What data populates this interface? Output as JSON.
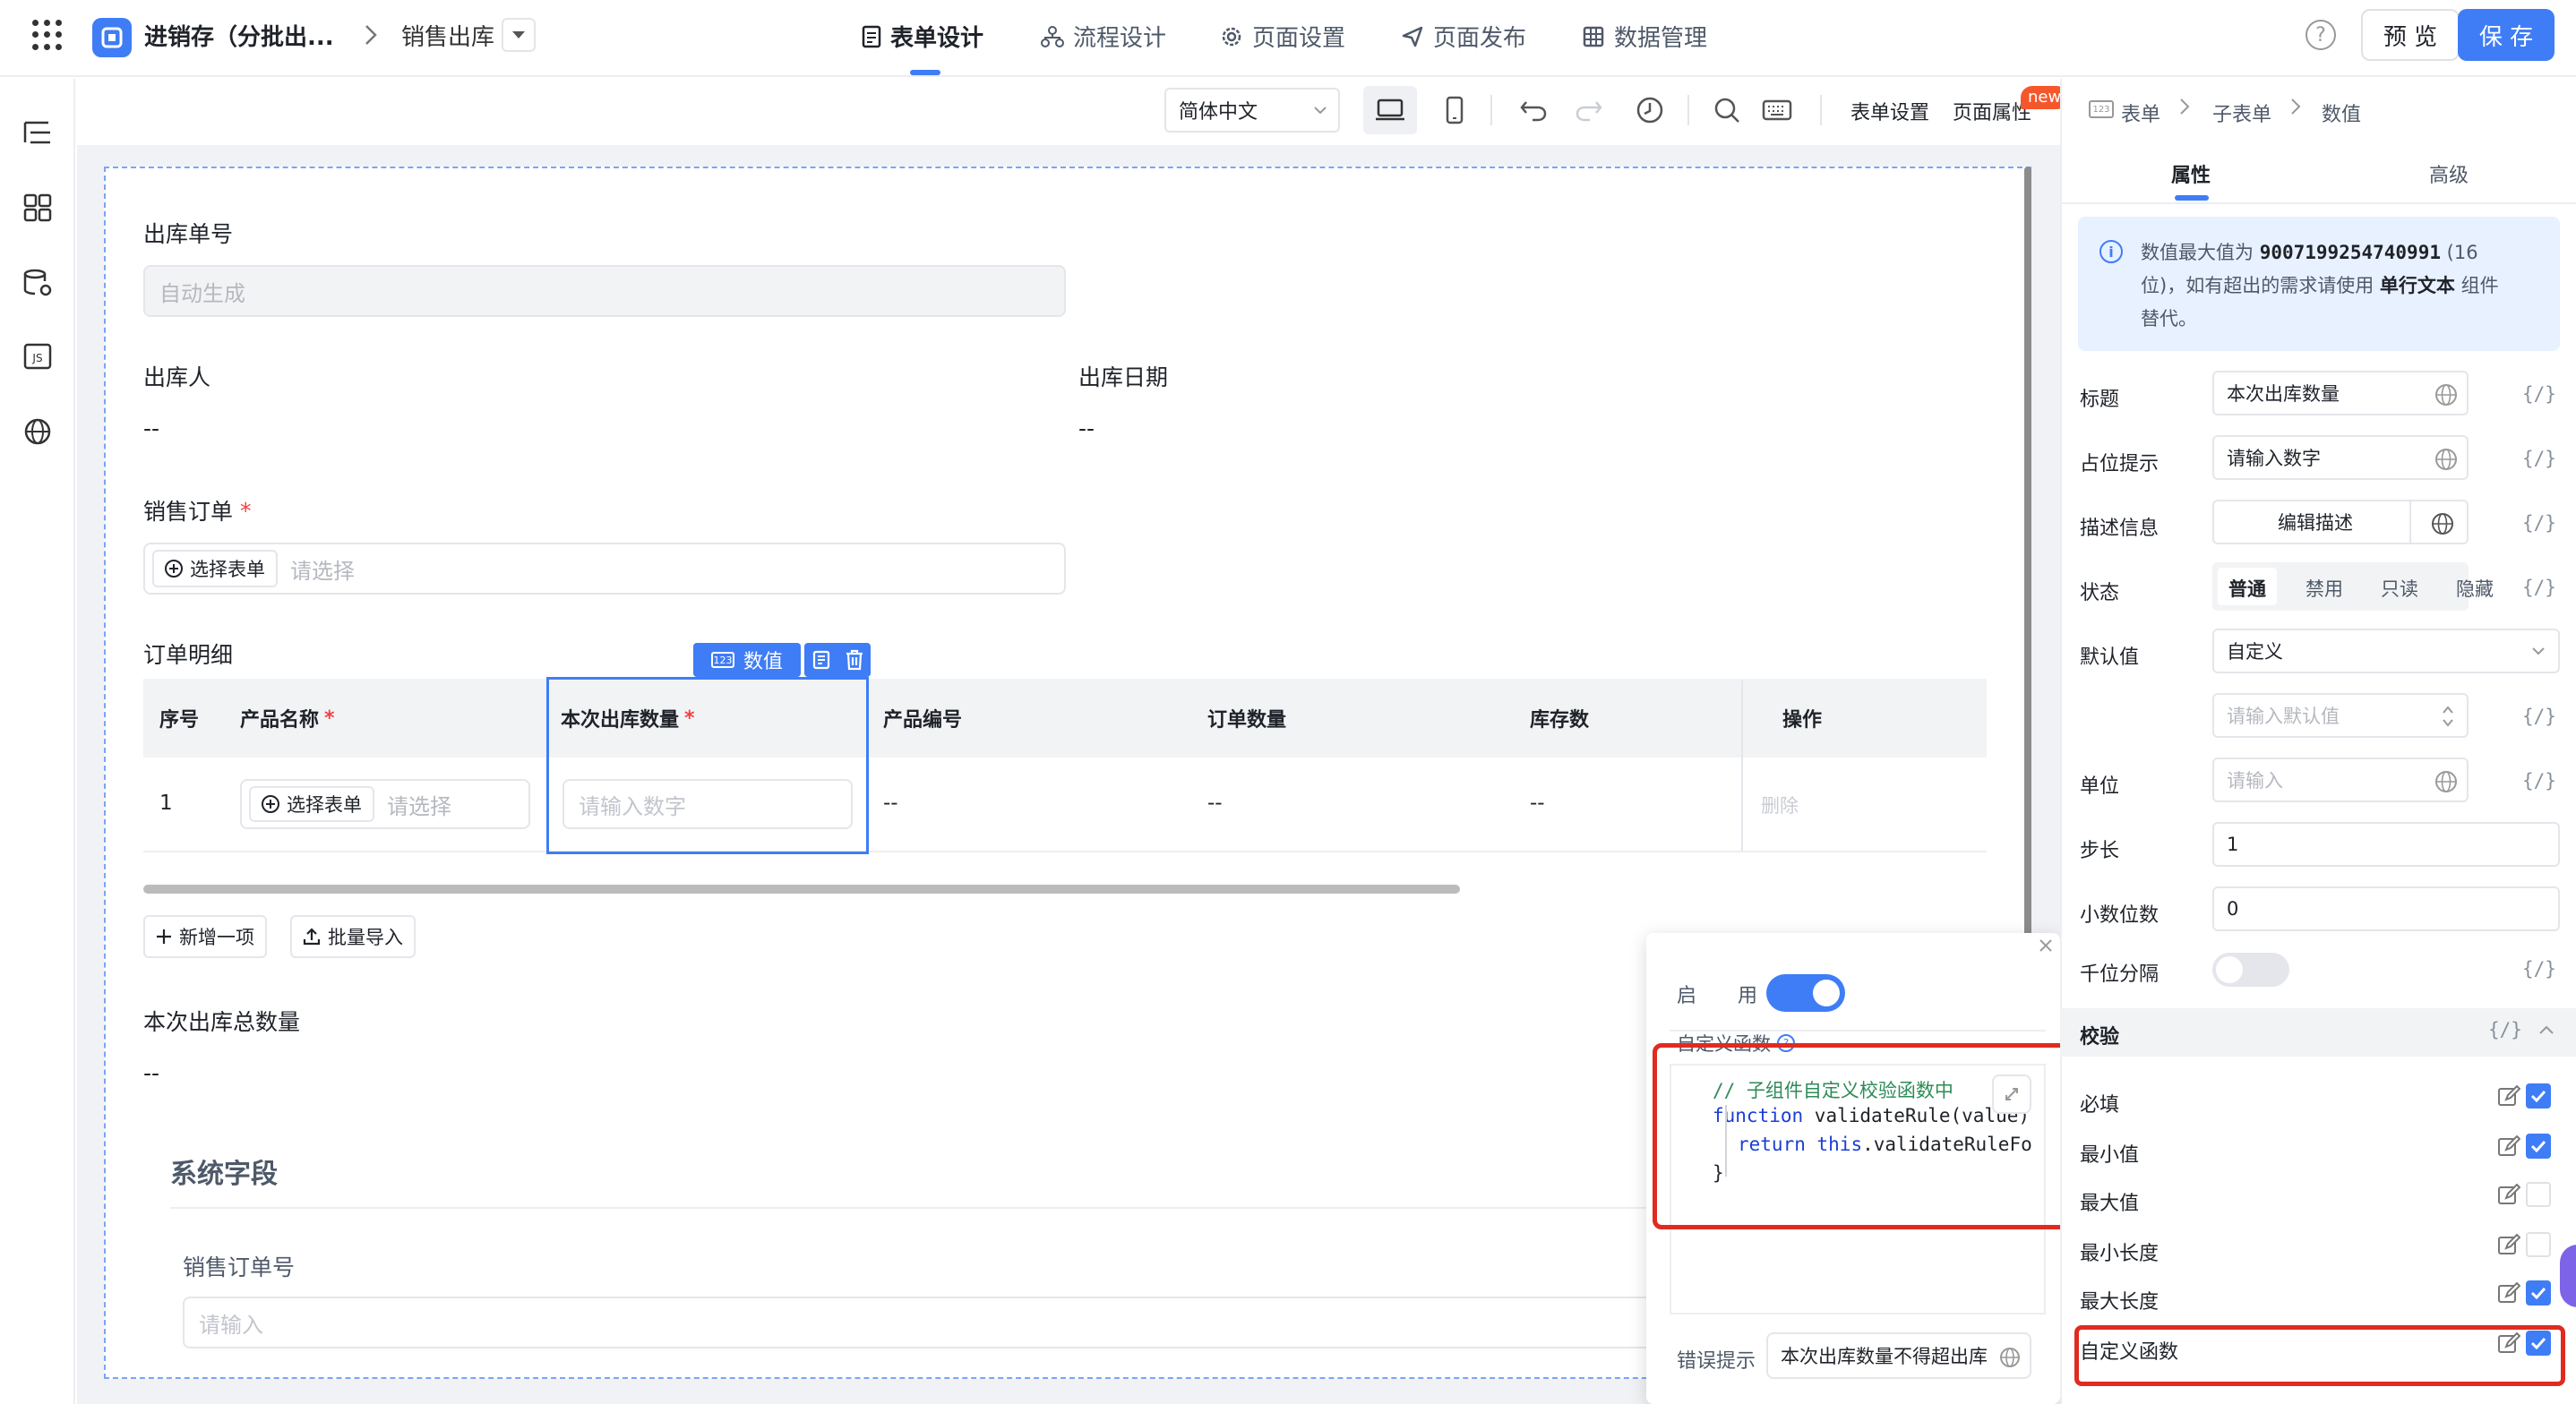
{
  "header": {
    "app_name": "进销存（分批出...",
    "page_name": "销售出库",
    "tabs": [
      {
        "label": "表单设计"
      },
      {
        "label": "流程设计"
      },
      {
        "label": "页面设置"
      },
      {
        "label": "页面发布"
      },
      {
        "label": "数据管理"
      }
    ],
    "help": "?",
    "preview": "预 览",
    "save": "保 存"
  },
  "toolbar": {
    "language": "简体中文",
    "form_settings": "表单设置",
    "page_props": "页面属性",
    "new_badge": "new"
  },
  "form": {
    "order_no_label": "出库单号",
    "order_no_value": "自动生成",
    "operator_label": "出库人",
    "operator_value": "--",
    "date_label": "出库日期",
    "date_value": "--",
    "sales_order_label": "销售订单",
    "req": "*",
    "select_form": "选择表单",
    "select_ph": "请选择",
    "detail_label": "订单明细",
    "selected_tag": "数值",
    "columns": {
      "index": "序号",
      "product": "产品名称",
      "qty": "本次出库数量",
      "code": "产品编号",
      "order_qty": "订单数量",
      "stock": "库存数",
      "action": "操作"
    },
    "row": {
      "index": "1",
      "select_form": "选择表单",
      "select_ph": "请选择",
      "qty_ph": "请输入数字",
      "code": "--",
      "order_qty": "--",
      "stock": "--",
      "delete": "删除"
    },
    "add_row": "新增一项",
    "batch_import": "批量导入",
    "total_label": "本次出库总数量",
    "total_value": "--",
    "system_title": "系统字段",
    "sys_order_label": "销售订单号",
    "sys_order_ph": "请输入"
  },
  "popup": {
    "enable_1": "启",
    "enable_2": "用",
    "custom_fn_label": "自定义函数",
    "code": {
      "l1": "// 子组件自定义校验函数中",
      "l2_kw": "function",
      "l2_rest": " validateRule(value)",
      "l3_kw": "return",
      "l3_this": "this",
      "l3_rest": ".validateRuleFo",
      "l4": "}"
    },
    "error_label": "错误提示",
    "error_value": "本次出库数量不得超出库"
  },
  "right_panel": {
    "crumbs": [
      "表单",
      "子表单",
      "数值"
    ],
    "tab_props": "属性",
    "tab_adv": "高级",
    "info_line1_a": "数值最大值为",
    "info_max": "9007199254740991",
    "info_line1_b": "(16",
    "info_line2_a": "位)，如有超出的需求请使用",
    "info_single": "单行文本",
    "info_line2_b": "组件",
    "info_line3": "替代。",
    "fx": "{/}",
    "title_label": "标题",
    "title_value": "本次出库数量",
    "placeholder_label": "占位提示",
    "placeholder_value": "请输入数字",
    "desc_label": "描述信息",
    "desc_button": "编辑描述",
    "status_label": "状态",
    "status_options": [
      "普通",
      "禁用",
      "只读",
      "隐藏"
    ],
    "default_label": "默认值",
    "default_value": "自定义",
    "default_ph": "请输入默认值",
    "unit_label": "单位",
    "unit_ph": "请输入",
    "step_label": "步长",
    "step_value": "1",
    "decimal_label": "小数位数",
    "decimal_value": "0",
    "thousand_label": "千位分隔",
    "verify_label": "校验",
    "rules": [
      {
        "label": "必填",
        "checked": true
      },
      {
        "label": "最小值",
        "checked": true
      },
      {
        "label": "最大值",
        "checked": false
      },
      {
        "label": "最小长度",
        "checked": false
      },
      {
        "label": "最大长度",
        "checked": true
      },
      {
        "label": "自定义函数",
        "checked": true
      }
    ]
  },
  "colors": {
    "accent": "#3f7df6",
    "danger": "#e02b20",
    "required": "#f53f3f"
  }
}
